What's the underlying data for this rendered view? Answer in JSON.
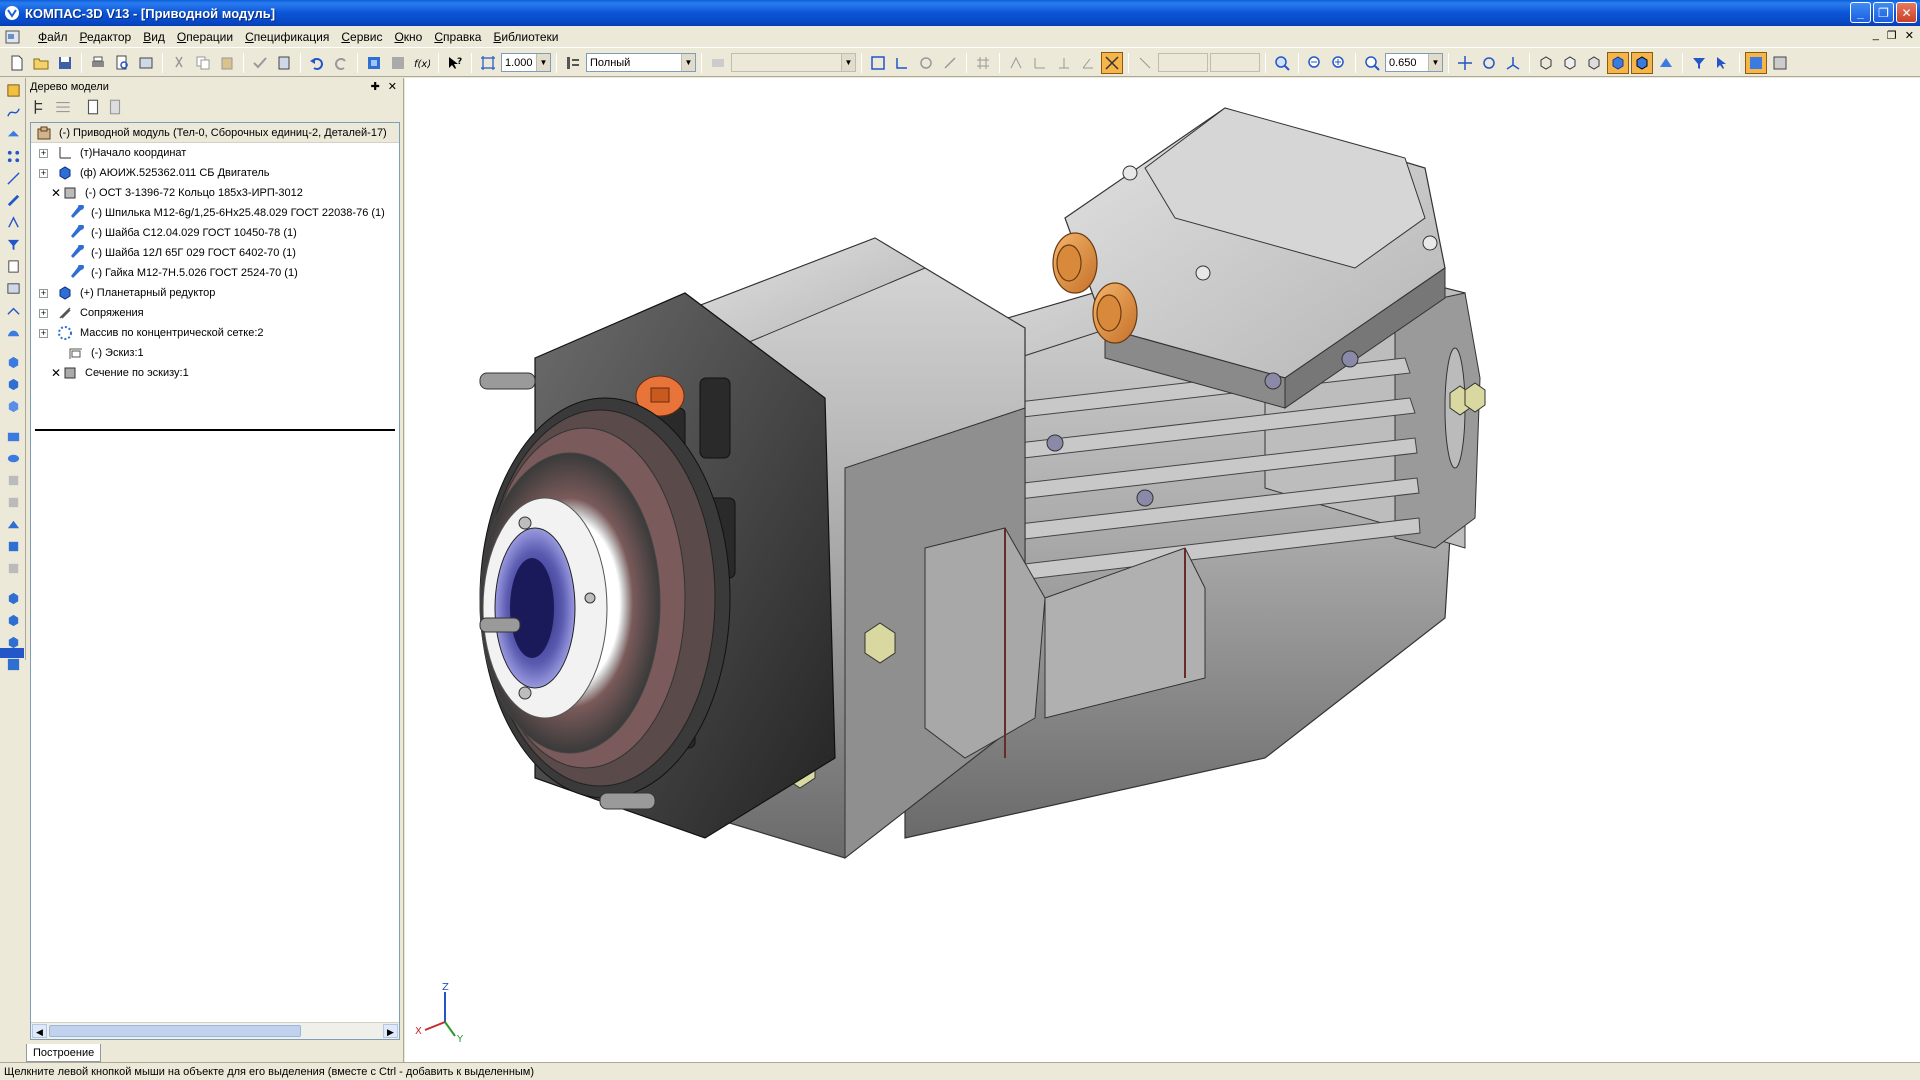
{
  "window": {
    "title": "КОМПАС-3D V13 - [Приводной модуль]",
    "controls": {
      "minimize": "_",
      "restore": "❐",
      "close": "✕"
    }
  },
  "menu": {
    "items": [
      "Файл",
      "Редактор",
      "Вид",
      "Операции",
      "Спецификация",
      "Сервис",
      "Окно",
      "Справка",
      "Библиотеки"
    ],
    "mdi": {
      "minimize": "_",
      "restore": "❐",
      "close": "✕"
    }
  },
  "toolbar": {
    "scale_value": "1.000",
    "display_mode": "Полный",
    "zoom_value": "0.650"
  },
  "tree_panel": {
    "title": "Дерево модели",
    "root": "(-) Приводной модуль (Тел-0, Сборочных единиц-2, Деталей-17)",
    "items": [
      {
        "label": "(т)Начало координат",
        "expand": "+",
        "x": false,
        "icon": "origin-icon"
      },
      {
        "label": "(ф) АЮИЖ.525362.011 СБ Двигатель",
        "expand": "+",
        "x": false,
        "icon": "assembly-icon"
      },
      {
        "label": "(-) ОСТ 3-1396-72 Кольцо 185х3-ИРП-3012",
        "expand": "",
        "x": true,
        "icon": "part-icon"
      },
      {
        "label": "(-) Шпилька М12-6g/1,25-6Hx25.48.029 ГОСТ 22038-76 (1)",
        "expand": "",
        "x": false,
        "icon": "standard-part-icon"
      },
      {
        "label": "(-) Шайба С12.04.029 ГОСТ 10450-78 (1)",
        "expand": "",
        "x": false,
        "icon": "standard-part-icon"
      },
      {
        "label": "(-) Шайба 12Л 65Г 029 ГОСТ 6402-70 (1)",
        "expand": "",
        "x": false,
        "icon": "standard-part-icon"
      },
      {
        "label": "(-) Гайка М12-7Н.5.026 ГОСТ 2524-70 (1)",
        "expand": "",
        "x": false,
        "icon": "standard-part-icon"
      },
      {
        "label": "(+) Планетарный редуктор",
        "expand": "+",
        "x": false,
        "icon": "assembly-icon"
      },
      {
        "label": "Сопряжения",
        "expand": "+",
        "x": false,
        "icon": "mates-icon"
      },
      {
        "label": "Массив по концентрической сетке:2",
        "expand": "+",
        "x": false,
        "icon": "pattern-icon"
      },
      {
        "label": "(-) Эскиз:1",
        "expand": "",
        "x": false,
        "icon": "sketch-icon"
      },
      {
        "label": "Сечение по эскизу:1",
        "expand": "",
        "x": true,
        "icon": "section-icon"
      }
    ],
    "tab_label": "Построение"
  },
  "viewport": {
    "axes": {
      "x": "X",
      "y": "Y",
      "z": "Z"
    }
  },
  "status": "Щелкните левой кнопкой мыши на объекте для его выделения (вместе с Ctrl - добавить к выделенным)"
}
